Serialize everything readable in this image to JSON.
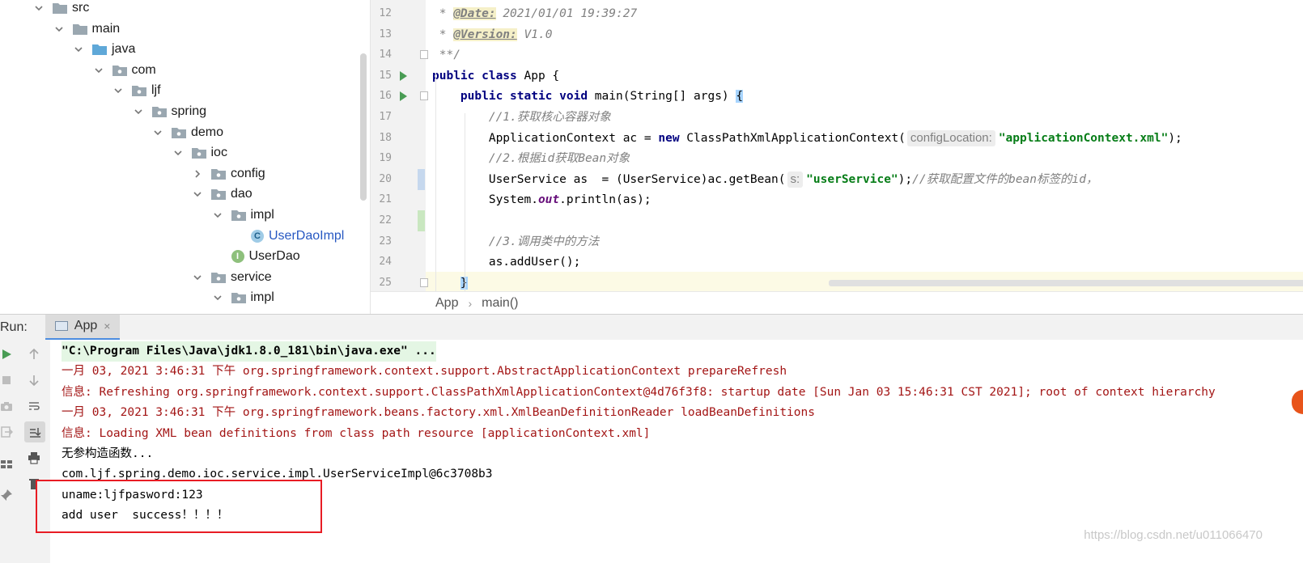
{
  "project_tree": {
    "items": [
      {
        "label": "src",
        "kind": "folder",
        "expanded": true
      },
      {
        "label": "main",
        "kind": "folder",
        "expanded": true
      },
      {
        "label": "java",
        "kind": "source-folder",
        "expanded": true
      },
      {
        "label": "com",
        "kind": "package",
        "expanded": true
      },
      {
        "label": "ljf",
        "kind": "package",
        "expanded": true
      },
      {
        "label": "spring",
        "kind": "package",
        "expanded": true
      },
      {
        "label": "demo",
        "kind": "package",
        "expanded": true
      },
      {
        "label": "ioc",
        "kind": "package",
        "expanded": true
      },
      {
        "label": "config",
        "kind": "package",
        "expanded": false
      },
      {
        "label": "dao",
        "kind": "package",
        "expanded": true
      },
      {
        "label": "impl",
        "kind": "package",
        "expanded": true
      },
      {
        "label": "UserDaoImpl",
        "kind": "class"
      },
      {
        "label": "UserDao",
        "kind": "interface"
      },
      {
        "label": "service",
        "kind": "package",
        "expanded": true
      },
      {
        "label": "impl",
        "kind": "package",
        "expanded": true
      }
    ]
  },
  "editor": {
    "lines": [
      {
        "no": "12",
        "parts": [
          {
            "t": " * ",
            "c": "cm"
          },
          {
            "t": "@Date:",
            "c": "doctag"
          },
          {
            "t": " 2021/01/01 19:39:27",
            "c": "docval"
          }
        ]
      },
      {
        "no": "13",
        "parts": [
          {
            "t": " * ",
            "c": "cm"
          },
          {
            "t": "@Version:",
            "c": "doctag"
          },
          {
            "t": " V1.0",
            "c": "docval"
          }
        ]
      },
      {
        "no": "14",
        "parts": [
          {
            "t": " **/",
            "c": "cm"
          }
        ]
      },
      {
        "no": "15",
        "parts": [
          {
            "t": "public class ",
            "c": "kw"
          },
          {
            "t": "App {",
            "c": ""
          }
        ]
      },
      {
        "no": "16",
        "parts": [
          {
            "t": "    public static void ",
            "c": "kw"
          },
          {
            "t": "main(String[] args) ",
            "c": ""
          },
          {
            "t": "{",
            "c": "brace-hl"
          }
        ]
      },
      {
        "no": "17",
        "parts": [
          {
            "t": "        //1.获取核心容器对象",
            "c": "cm"
          }
        ]
      },
      {
        "no": "18",
        "parts": [
          {
            "t": "        ApplicationContext ac = ",
            "c": ""
          },
          {
            "t": "new ",
            "c": "kw"
          },
          {
            "t": "ClassPathXmlApplicationContext(",
            "c": ""
          },
          {
            "t": "configLocation:",
            "c": "hint"
          },
          {
            "t": "\"applicationContext.xml\"",
            "c": "st"
          },
          {
            "t": ");",
            "c": ""
          }
        ]
      },
      {
        "no": "19",
        "parts": [
          {
            "t": "        //2.根据id获取Bean对象",
            "c": "cm"
          }
        ]
      },
      {
        "no": "20",
        "parts": [
          {
            "t": "        UserService as  = (UserService)ac.getBean(",
            "c": ""
          },
          {
            "t": "s:",
            "c": "hint"
          },
          {
            "t": "\"userService\"",
            "c": "st"
          },
          {
            "t": ");",
            "c": ""
          },
          {
            "t": "//获取配置文件的bean标签的id，",
            "c": "cm"
          }
        ]
      },
      {
        "no": "21",
        "parts": [
          {
            "t": "        System.",
            "c": ""
          },
          {
            "t": "out",
            "c": "fld"
          },
          {
            "t": ".println(as);",
            "c": ""
          }
        ]
      },
      {
        "no": "22",
        "parts": [
          {
            "t": "",
            "c": ""
          }
        ]
      },
      {
        "no": "23",
        "parts": [
          {
            "t": "        //3.调用类中的方法",
            "c": "cm"
          }
        ]
      },
      {
        "no": "24",
        "parts": [
          {
            "t": "        as.addUser();",
            "c": ""
          }
        ]
      },
      {
        "no": "25",
        "parts": [
          {
            "t": "    ",
            "c": ""
          },
          {
            "t": "}",
            "c": "brace-hl"
          }
        ]
      }
    ]
  },
  "breadcrumb": {
    "items": [
      "App",
      "main()"
    ]
  },
  "run_panel": {
    "label": "Run:",
    "tab_label": "App",
    "close_glyph": "×"
  },
  "console": {
    "lines": [
      {
        "text": "\"C:\\Program Files\\Java\\jdk1.8.0_181\\bin\\java.exe\" ...",
        "style": "cmdline"
      },
      {
        "text": "一月 03, 2021 3:46:31 下午 org.springframework.context.support.AbstractApplicationContext prepareRefresh",
        "style": "red"
      },
      {
        "text": "信息: Refreshing org.springframework.context.support.ClassPathXmlApplicationContext@4d76f3f8: startup date [Sun Jan 03 15:46:31 CST 2021]; root of context hierarchy",
        "style": "red"
      },
      {
        "text": "一月 03, 2021 3:46:31 下午 org.springframework.beans.factory.xml.XmlBeanDefinitionReader loadBeanDefinitions",
        "style": "red"
      },
      {
        "text": "信息: Loading XML bean definitions from class path resource [applicationContext.xml]",
        "style": "red"
      },
      {
        "text": "无参构造函数...",
        "style": "blk"
      },
      {
        "text": "com.ljf.spring.demo.ioc.service.impl.UserServiceImpl@6c3708b3",
        "style": "blk"
      },
      {
        "text": "uname:ljfpasword:123",
        "style": "blk"
      },
      {
        "text": "add user  success！！！！",
        "style": "blk"
      }
    ]
  },
  "watermark": "https://blog.csdn.net/u011066470",
  "colors": {
    "highlight_box": "#e81c24",
    "accent_tab": "#4d8de0",
    "run_green": "#499c54"
  }
}
